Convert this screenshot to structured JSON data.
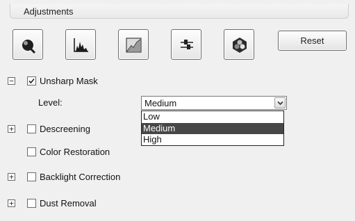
{
  "panel": {
    "title": "Adjustments"
  },
  "toolbar": {
    "tools": [
      {
        "icon": "auto-exposure-icon"
      },
      {
        "icon": "histogram-icon"
      },
      {
        "icon": "tone-curve-icon"
      },
      {
        "icon": "image-adjustment-sliders-icon"
      },
      {
        "icon": "color-palette-icon"
      }
    ],
    "reset_label": "Reset"
  },
  "options": {
    "unsharp_mask": {
      "label": "Unsharp Mask",
      "checked": true,
      "expander": "−"
    },
    "level": {
      "label": "Level:",
      "value": "Medium",
      "options": [
        "Low",
        "Medium",
        "High"
      ],
      "selected_index": 1
    },
    "descreening": {
      "label": "Descreening",
      "checked": false,
      "expander": "+"
    },
    "color_restoration": {
      "label": "Color Restoration",
      "checked": false
    },
    "backlight_correction": {
      "label": "Backlight Correction",
      "checked": false,
      "expander": "+"
    },
    "dust_removal": {
      "label": "Dust Removal",
      "checked": false,
      "expander": "+"
    }
  }
}
